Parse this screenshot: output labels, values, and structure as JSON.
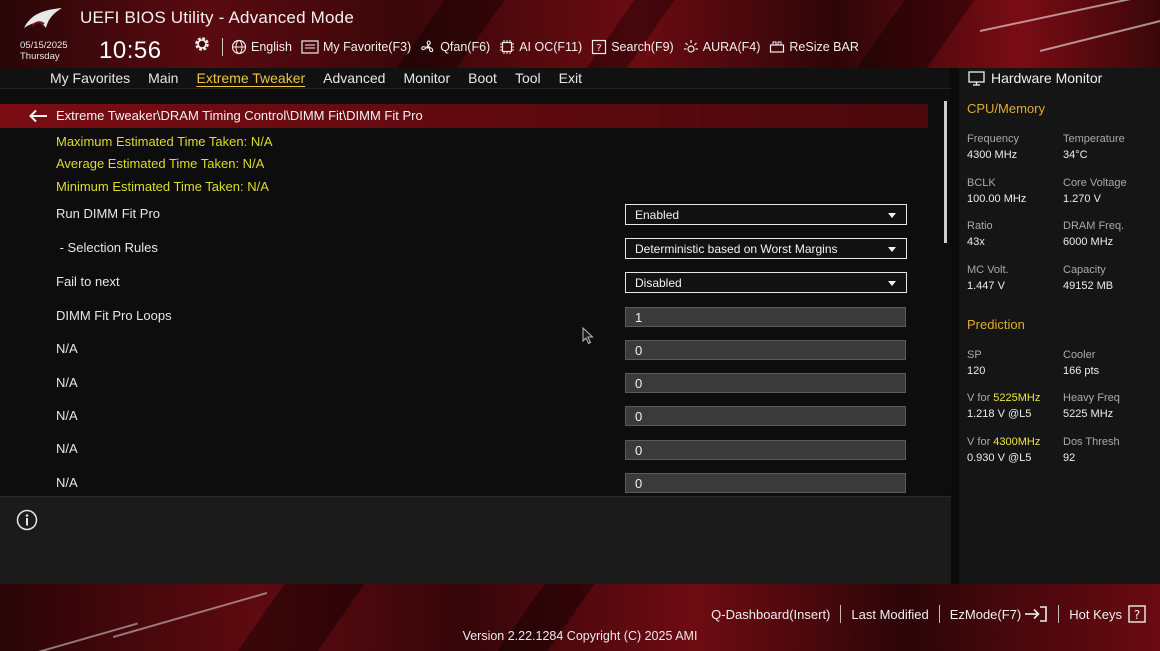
{
  "header": {
    "title": "UEFI BIOS Utility - Advanced Mode",
    "date": "05/15/2025",
    "weekday": "Thursday",
    "time": "10:56",
    "nav": [
      {
        "label": "English",
        "icon": "globe-icon"
      },
      {
        "label": "My Favorite(F3)",
        "icon": "favorite-icon"
      },
      {
        "label": "Qfan(F6)",
        "icon": "fan-icon"
      },
      {
        "label": "AI OC(F11)",
        "icon": "ai-chip-icon"
      },
      {
        "label": "Search(F9)",
        "icon": "search-help-icon"
      },
      {
        "label": "AURA(F4)",
        "icon": "aura-light-icon"
      },
      {
        "label": "ReSize BAR",
        "icon": "resize-bar-icon"
      }
    ]
  },
  "tabs": [
    {
      "label": "My Favorites",
      "active": false
    },
    {
      "label": "Main",
      "active": false
    },
    {
      "label": "Extreme Tweaker",
      "active": true
    },
    {
      "label": "Advanced",
      "active": false
    },
    {
      "label": "Monitor",
      "active": false
    },
    {
      "label": "Boot",
      "active": false
    },
    {
      "label": "Tool",
      "active": false
    },
    {
      "label": "Exit",
      "active": false
    }
  ],
  "content": {
    "breadcrumb": "Extreme Tweaker\\DRAM Timing Control\\DIMM Fit\\DIMM Fit Pro",
    "info_lines": [
      "Maximum Estimated Time Taken: N/A",
      "Average Estimated Time Taken: N/A",
      "Minimum Estimated Time Taken: N/A"
    ],
    "settings": [
      {
        "label": "Run DIMM Fit Pro",
        "type": "select",
        "value": "Enabled"
      },
      {
        "label": " - Selection Rules",
        "type": "select",
        "value": "Deterministic based on Worst Margins"
      },
      {
        "label": "Fail to next",
        "type": "select",
        "value": "Disabled"
      },
      {
        "label": "DIMM Fit Pro Loops",
        "type": "number",
        "value": "1"
      },
      {
        "label": "N/A",
        "type": "number",
        "value": "0"
      },
      {
        "label": "N/A",
        "type": "number",
        "value": "0"
      },
      {
        "label": "N/A",
        "type": "number",
        "value": "0"
      },
      {
        "label": "N/A",
        "type": "number",
        "value": "0"
      },
      {
        "label": "N/A",
        "type": "number",
        "value": "0"
      }
    ]
  },
  "hardware_monitor": {
    "title": "Hardware Monitor",
    "cpu_memory": {
      "heading": "CPU/Memory",
      "items": [
        {
          "label": "Frequency",
          "value": "4300 MHz"
        },
        {
          "label": "Temperature",
          "value": "34°C"
        },
        {
          "label": "BCLK",
          "value": "100.00 MHz"
        },
        {
          "label": "Core Voltage",
          "value": "1.270 V"
        },
        {
          "label": "Ratio",
          "value": "43x"
        },
        {
          "label": "DRAM Freq.",
          "value": "6000 MHz"
        },
        {
          "label": "MC Volt.",
          "value": "1.447 V"
        },
        {
          "label": "Capacity",
          "value": "49152 MB"
        }
      ]
    },
    "prediction": {
      "heading": "Prediction",
      "items": [
        {
          "label": "SP",
          "value": "120"
        },
        {
          "label": "Cooler",
          "value": "166 pts"
        },
        {
          "label_prefix": "V for ",
          "label_highlight": "5225MHz",
          "value": "1.218 V @L5"
        },
        {
          "label": "Heavy Freq",
          "value": "5225 MHz"
        },
        {
          "label_prefix": "V for ",
          "label_highlight": "4300MHz",
          "value": "0.930 V @L5"
        },
        {
          "label": "Dos Thresh",
          "value": "92"
        }
      ]
    }
  },
  "footer": {
    "buttons": [
      "Q-Dashboard(Insert)",
      "Last Modified",
      "EzMode(F7)",
      "Hot Keys"
    ],
    "version": "Version 2.22.1284 Copyright (C) 2025 AMI"
  },
  "colors": {
    "accent_yellow": "#f5c242",
    "info_yellow": "#dcdc2a",
    "prediction_orange": "#e2a92e",
    "breadcrumb_red": "#7a0c12"
  }
}
